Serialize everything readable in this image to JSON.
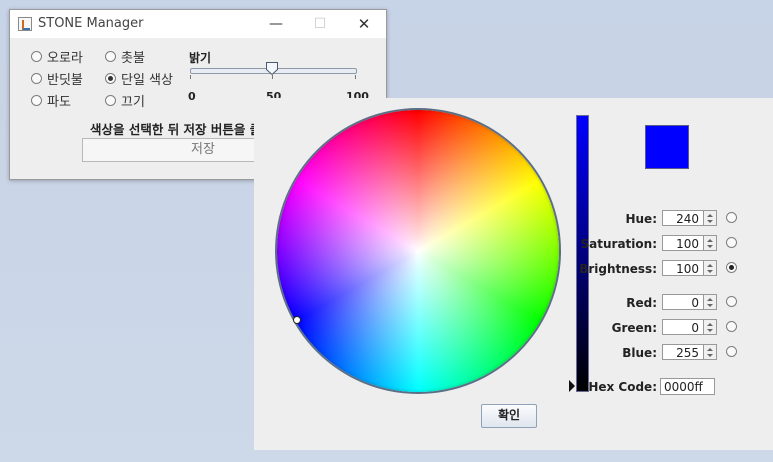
{
  "stone_window": {
    "title": "STONE Manager",
    "minimize_icon": "—",
    "maximize_icon": "☐",
    "close_icon": "✕",
    "modes": [
      {
        "label": "오로라",
        "selected": false
      },
      {
        "label": "반딧불",
        "selected": false
      },
      {
        "label": "파도",
        "selected": false
      },
      {
        "label": "촛불",
        "selected": false
      },
      {
        "label": "단일 색상",
        "selected": true
      },
      {
        "label": "끄기",
        "selected": false
      }
    ],
    "brightness": {
      "title": "밝기",
      "value": 50,
      "min": 0,
      "max": 100,
      "tick_labels": [
        "0",
        "50",
        "100"
      ]
    },
    "instruction": "색상을 선택한 뒤 저장 버튼을 클",
    "save_label": "저장"
  },
  "color_chooser": {
    "selected_color": "#0000ff",
    "fields": [
      {
        "label": "Hue:",
        "value": "240",
        "selected": false
      },
      {
        "label": "Saturation:",
        "value": "100",
        "selected": false
      },
      {
        "label": "Brightness:",
        "value": "100",
        "selected": true
      },
      {
        "label": "Red:",
        "value": "0",
        "selected": false
      },
      {
        "label": "Green:",
        "value": "0",
        "selected": false
      },
      {
        "label": "Blue:",
        "value": "255",
        "selected": false
      }
    ],
    "hex_label": "Hex Code:",
    "hex_value": "0000ff",
    "ok_label": "확인"
  }
}
